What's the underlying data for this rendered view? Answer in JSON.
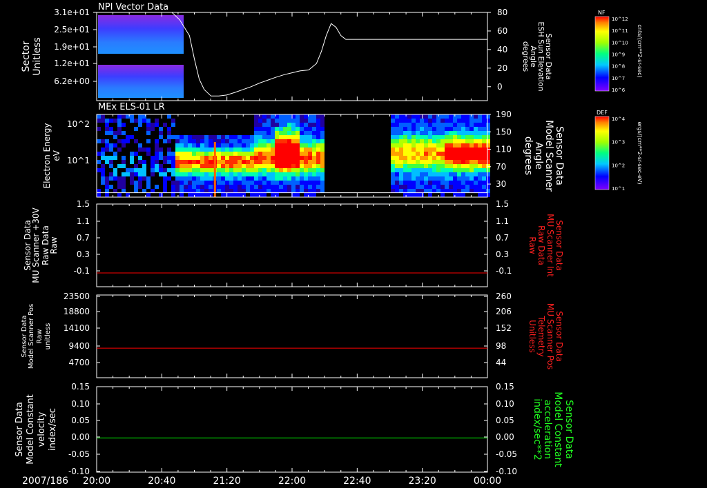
{
  "chart_data": [
    {
      "type": "line",
      "id": "p1",
      "title": "NPI Vector Data",
      "ylabel_left": [
        "Sector",
        "Unitless"
      ],
      "left_ticks": [
        "3.1e+01",
        "2.5e+01",
        "1.9e+01",
        "1.2e+01",
        "6.2e+00"
      ],
      "ylabel_right": [
        "Sensor Data",
        "ESH Sun Elevation",
        "Angle",
        "degrees"
      ],
      "right_ticks": [
        "80",
        "60",
        "40",
        "20",
        "0"
      ],
      "right_ylim": [
        -15,
        80
      ],
      "series": [
        {
          "x": [
            20.77,
            20.85,
            20.95,
            21.0,
            21.05,
            21.1,
            21.17,
            21.25,
            21.33,
            21.42,
            21.5,
            21.58,
            21.67,
            21.75,
            21.83,
            21.92,
            22.0,
            22.08,
            22.17,
            22.25,
            22.3,
            22.35,
            22.4,
            22.45,
            22.5,
            22.55,
            24.0
          ],
          "y": [
            80,
            72,
            55,
            30,
            8,
            -3,
            -10,
            -10,
            -9,
            -6,
            -3,
            0,
            4,
            7,
            10,
            13,
            15,
            17,
            18,
            25,
            38,
            55,
            68,
            64,
            55,
            51,
            51
          ],
          "color": "#ffffff"
        }
      ],
      "colorbar": {
        "label": "NF",
        "unit": "cnts/(cm**2-sr-sec)",
        "ticks": [
          "10^12",
          "10^11",
          "10^10",
          "10^9",
          "10^8",
          "10^7",
          "10^6"
        ]
      }
    },
    {
      "type": "heatmap",
      "id": "p2",
      "title": "MEx ELS-01 LR",
      "ylabel_left": [
        "Electron Energy",
        "eV"
      ],
      "left_ticks": [
        "10^2",
        "10^1"
      ],
      "ylabel_right": [
        "Sensor Data",
        "Model Scanner",
        "Angle",
        "degrees"
      ],
      "right_ticks": [
        "190",
        "150",
        "110",
        "70",
        "30"
      ],
      "right_ylim": [
        0,
        190
      ],
      "data_gaps": [
        [
          22.33,
          23.0
        ]
      ],
      "overlay_line_value": 10,
      "colorbar": {
        "label": "DEF",
        "unit": "ergs/(cm**2-sr-sec-eV)",
        "ticks": [
          "10^4",
          "10^3",
          "10^2",
          "10^1"
        ]
      }
    },
    {
      "type": "line",
      "id": "p3",
      "ylabel_left": [
        "Sensor Data",
        "MU Scanner +30V",
        "Raw Data",
        "Raw"
      ],
      "left_ticks": [
        "1.5",
        "1.1",
        "0.7",
        "0.3",
        "-0.1"
      ],
      "ylabel_right": [
        "Sensor Data",
        "MU Scanner Int",
        "Raw Data",
        "Raw"
      ],
      "right_ticks": [
        "1.5",
        "1.1",
        "0.7",
        "0.3",
        "-0.1"
      ],
      "ylim": [
        -0.3,
        1.5
      ],
      "series": [
        {
          "name": "Raw",
          "x": [
            20,
            24
          ],
          "y": [
            0,
            0
          ],
          "color": "#ff0000"
        }
      ]
    },
    {
      "type": "line",
      "id": "p4",
      "ylabel_left": [
        "Sensor Data",
        "Model Scanner Pos",
        "Raw",
        "unitless"
      ],
      "left_ticks": [
        "23500",
        "18800",
        "14100",
        "9400",
        "4700"
      ],
      "ylabel_right": [
        "Sensor Data",
        "MU Scanner Pos",
        "Telemetry",
        "Unitless"
      ],
      "right_ticks": [
        "260",
        "206",
        "152",
        "98",
        "44"
      ],
      "ylim": [
        0,
        23500
      ],
      "series": [
        {
          "name": "Pos",
          "x": [
            20,
            24
          ],
          "y": [
            8400,
            8400
          ],
          "color": "#ff0000"
        }
      ]
    },
    {
      "type": "line",
      "id": "p5",
      "ylabel_left": [
        "Sensor Data",
        "Model Constant",
        "velocity",
        "index/sec"
      ],
      "left_ticks": [
        "0.15",
        "0.10",
        "0.05",
        "0.00",
        "-0.05",
        "-0.10"
      ],
      "ylabel_right": [
        "Sensor Data",
        "Model Constant",
        "acceleration",
        "index/sec**2"
      ],
      "right_ticks": [
        "0.15",
        "0.10",
        "0.05",
        "0.00",
        "-0.05",
        "-0.10"
      ],
      "ylim": [
        -0.1,
        0.15
      ],
      "series": [
        {
          "name": "velocity",
          "x": [
            20,
            24
          ],
          "y": [
            0,
            0
          ],
          "color": "#00ff00"
        }
      ]
    }
  ],
  "x_axis": {
    "date_label": "2007/186",
    "ticks": [
      "20:00",
      "20:40",
      "21:20",
      "22:00",
      "22:40",
      "23:20",
      "00:00"
    ],
    "xlim_hours": [
      20,
      24
    ]
  },
  "colors": {
    "background": "#000000",
    "axes": "#ffffff",
    "red_label": "#ff2020",
    "green_label": "#20ff20"
  }
}
